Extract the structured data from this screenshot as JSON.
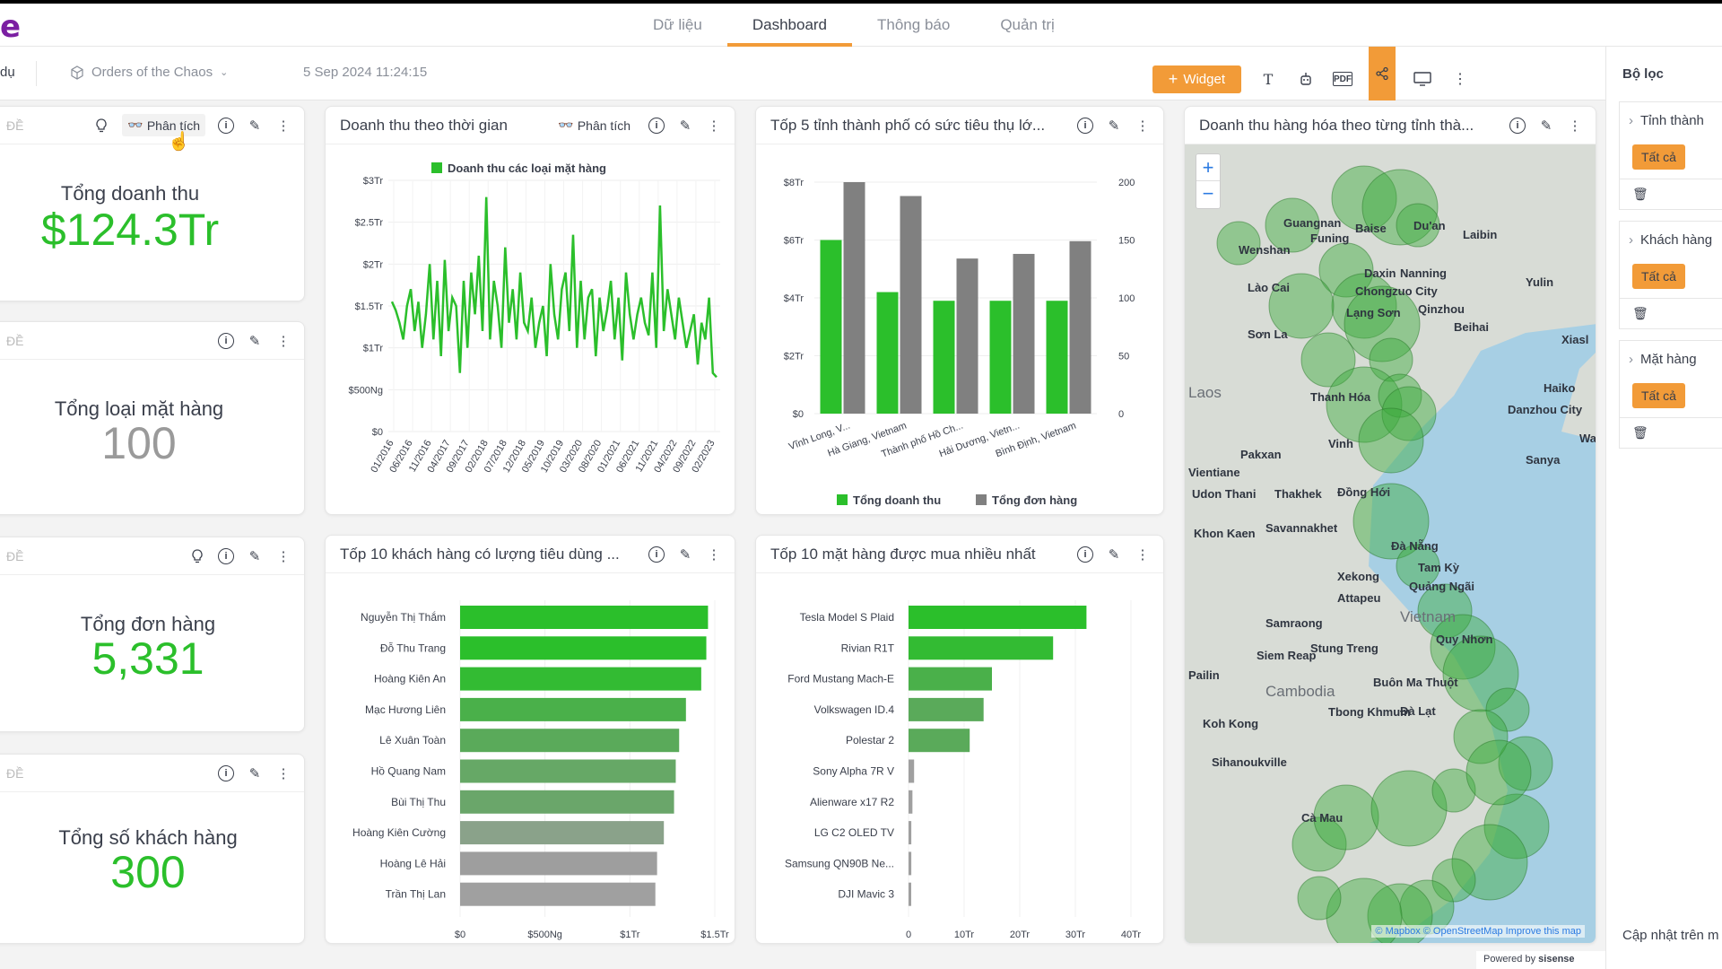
{
  "app": {
    "logo": "e"
  },
  "nav": {
    "tabs": [
      "Dữ liệu",
      "Dashboard",
      "Thông báo",
      "Quản trị"
    ],
    "active": 1
  },
  "toolbar": {
    "left_text": "dụ",
    "dashboard_name": "Orders of the Chaos",
    "date": "5 Sep 2024 11:24:15",
    "widget_label": "Widget",
    "pdf_label": "PDF"
  },
  "filters": {
    "title": "Bộ lọc",
    "items": [
      {
        "name": "Tỉnh thành",
        "value": "Tất cả"
      },
      {
        "name": "Khách hàng",
        "value": "Tất cả"
      },
      {
        "name": "Mặt hàng",
        "value": "Tất cả"
      }
    ],
    "update_text": "Cập nhật trên m",
    "powered_by": "Powered by",
    "brand": "sisense"
  },
  "kpis": {
    "k1": {
      "head": "ĐỀ",
      "analysis": "Phân tích",
      "label": "Tổng doanh thu",
      "value": "$124.3Tr"
    },
    "k2": {
      "head": "ĐỀ",
      "label": "Tổng loại mặt hàng",
      "value": "100"
    },
    "k3": {
      "head": "ĐỀ",
      "label": "Tổng đơn hàng",
      "value": "5,331"
    },
    "k4": {
      "head": "ĐỀ",
      "label": "Tổng số khách hàng",
      "value": "300"
    }
  },
  "widgets": {
    "time": {
      "title": "Doanh thu theo thời gian",
      "analysis": "Phân tích"
    },
    "top5": {
      "title": "Tốp 5 tỉnh thành phố có sức tiêu thụ lớ..."
    },
    "map": {
      "title": "Doanh thu hàng hóa theo từng tỉnh thà..."
    },
    "top10c": {
      "title": "Tốp 10 khách hàng có lượng tiêu dùng ..."
    },
    "top10p": {
      "title": "Tốp 10 mặt hàng được mua nhiều nhất"
    }
  },
  "map": {
    "labels": [
      "Guangnan",
      "Baise",
      "Du'an",
      "Laibin",
      "Funing",
      "Wenshan",
      "Daxin",
      "Nanning",
      "Yulin",
      "Chongzuo City",
      "Qinzhou",
      "Beihai",
      "Lào Cai",
      "Lạng Sơn",
      "Sơn La",
      "Laos",
      "Thanh Hóa",
      "Pakxan",
      "Vientiane",
      "Udon Thani",
      "Thakhek",
      "Đồng Hới",
      "Savannakhet",
      "Khon Kaen",
      "Đà Nẵng",
      "Xekong",
      "Attapeu",
      "Quảng Ngãi",
      "Samraong",
      "Vietnam",
      "Quy Nhơn",
      "Siem Reap",
      "Stung Treng",
      "Pailin",
      "Cambodia",
      "Buôn Ma Thuột",
      "Koh Kong",
      "Tbong Khmum",
      "Sihanoukville",
      "Cà Mau",
      "Haiko",
      "Danzhou City",
      "Sanya",
      "Xiasl",
      "Wanr",
      "Vinh",
      "Tam Kỳ",
      "Đà Lạt"
    ],
    "attribution": "© Mapbox © OpenStreetMap Improve this map"
  },
  "chart_data": [
    {
      "type": "line",
      "title": "Doanh thu theo thời gian",
      "series": [
        {
          "name": "Doanh thu các loại mặt hàng",
          "color": "#2bbf2b"
        }
      ],
      "x_ticks": [
        "01/2016",
        "06/2016",
        "11/2016",
        "04/2017",
        "09/2017",
        "02/2018",
        "07/2018",
        "12/2018",
        "05/2019",
        "10/2019",
        "03/2020",
        "08/2020",
        "01/2021",
        "06/2021",
        "11/2021",
        "04/2022",
        "09/2022",
        "02/2023"
      ],
      "y_ticks": [
        "$0",
        "$500Ng",
        "$1Tr",
        "$1.5Tr",
        "$2Tr",
        "$2.5Tr",
        "$3Tr"
      ],
      "ylim": [
        0,
        3000000
      ],
      "values": [
        1.55,
        1.45,
        1.3,
        1.1,
        1.5,
        1.7,
        1.2,
        1.55,
        1.0,
        1.4,
        2.0,
        1.1,
        1.8,
        0.9,
        2.05,
        1.2,
        1.6,
        1.5,
        0.7,
        1.8,
        1.0,
        1.9,
        1.4,
        2.1,
        1.2,
        2.8,
        1.1,
        1.8,
        1.5,
        1.0,
        2.2,
        1.3,
        1.7,
        1.1,
        1.9,
        1.3,
        1.2,
        1.6,
        1.0,
        1.3,
        1.5,
        0.9,
        2.0,
        1.4,
        1.1,
        1.7,
        1.9,
        1.2,
        2.35,
        1.0,
        1.8,
        1.1,
        1.6,
        1.7,
        0.9,
        1.6,
        1.2,
        1.45,
        1.8,
        1.1,
        1.6,
        0.85,
        1.9,
        1.4,
        1.1,
        1.4,
        1.6,
        1.3,
        1.15,
        1.9,
        1.0,
        2.7,
        1.2,
        1.7,
        1.4,
        1.1,
        1.6,
        1.3,
        1.0,
        1.2,
        1.4,
        0.8,
        1.3,
        1.1,
        1.6,
        0.7,
        0.65
      ]
    },
    {
      "type": "bar",
      "title": "Tốp 5 tỉnh thành phố có sức tiêu thụ lớ...",
      "categories": [
        "Vĩnh Long, V...",
        "Hà Giang, Vietnam",
        "Thành phố Hồ Ch...",
        "Hải Dương, Vietn...",
        "Bình Định, Vietnam"
      ],
      "series": [
        {
          "name": "Tổng doanh thu",
          "color": "#2bbf2b",
          "axis": "left",
          "values": [
            6.0,
            4.2,
            3.9,
            3.9,
            3.9
          ]
        },
        {
          "name": "Tổng đơn hàng",
          "color": "#808080",
          "axis": "right",
          "values": [
            200,
            188,
            134,
            138,
            149
          ]
        }
      ],
      "y_left_ticks": [
        "$0",
        "$2Tr",
        "$4Tr",
        "$6Tr",
        "$8Tr"
      ],
      "y_left_lim": [
        0,
        8
      ],
      "y_right_ticks": [
        "0",
        "50",
        "100",
        "150",
        "200"
      ],
      "y_right_lim": [
        0,
        200
      ]
    },
    {
      "type": "bar",
      "orientation": "horizontal",
      "title": "Tốp 10 khách hàng có lượng tiêu dùng ...",
      "categories": [
        "Nguyễn Thị Thắm",
        "Đỗ Thu Trang",
        "Hoàng Kiên An",
        "Mạc Hương Liên",
        "Lê Xuân Toàn",
        "Hồ Quang Nam",
        "Bùi Thị Thu",
        "Hoàng Kiên Cường",
        "Hoàng Lê Hải",
        "Trần Thị Lan"
      ],
      "values": [
        1.46,
        1.45,
        1.42,
        1.33,
        1.29,
        1.27,
        1.26,
        1.2,
        1.16,
        1.15
      ],
      "x_ticks": [
        "$0",
        "$500Ng",
        "$1Tr",
        "$1.5Tr"
      ],
      "xlim": [
        0,
        1.5
      ],
      "colors": [
        "#2bbf2b",
        "#2bbf2b",
        "#33bb33",
        "#4ab04a",
        "#5aaa5a",
        "#66a866",
        "#6aa66a",
        "#8aa28a",
        "#9e9e9e",
        "#a0a0a0"
      ]
    },
    {
      "type": "bar",
      "orientation": "horizontal",
      "title": "Tốp 10 mặt hàng được mua nhiều nhất",
      "categories": [
        "Tesla Model S Plaid",
        "Rivian R1T",
        "Ford Mustang Mach-E",
        "Volkswagen ID.4",
        "Polestar 2",
        "Sony Alpha 7R V",
        "Alienware x17 R2",
        "LG C2 OLED TV",
        "Samsung QN90B Ne...",
        "DJI Mavic 3"
      ],
      "values": [
        32.0,
        26.0,
        15.0,
        13.5,
        11.0,
        1.0,
        0.7,
        0.5,
        0.5,
        0.4
      ],
      "x_ticks": [
        "0",
        "10Tr",
        "20Tr",
        "30Tr",
        "40Tr"
      ],
      "xlim": [
        0,
        40
      ],
      "colors": [
        "#2bbf2b",
        "#33bb33",
        "#4ab04a",
        "#5aaa5a",
        "#5aaa5a",
        "#a0a0a0",
        "#a0a0a0",
        "#a0a0a0",
        "#a0a0a0",
        "#a0a0a0"
      ]
    }
  ]
}
